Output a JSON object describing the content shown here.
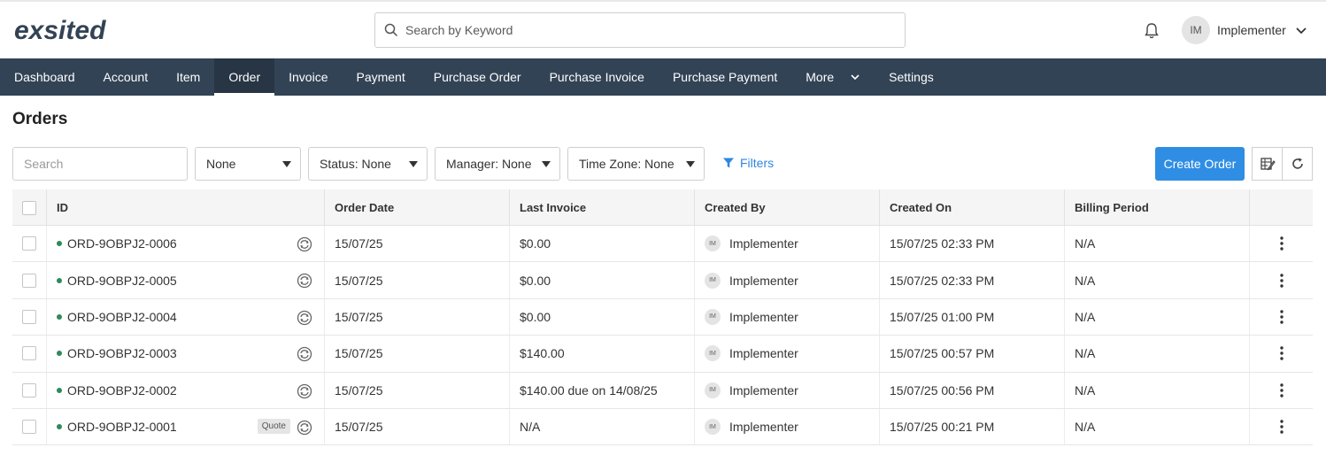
{
  "brand": {
    "logo_text": "exsited",
    "accent": "#f15a29",
    "dark": "#324355"
  },
  "header": {
    "search_placeholder": "Search by Keyword",
    "user_initials": "IM",
    "user_name": "Implementer"
  },
  "nav": {
    "items": [
      {
        "label": "Dashboard"
      },
      {
        "label": "Account"
      },
      {
        "label": "Item"
      },
      {
        "label": "Order",
        "active": true
      },
      {
        "label": "Invoice"
      },
      {
        "label": "Payment"
      },
      {
        "label": "Purchase Order"
      },
      {
        "label": "Purchase Invoice"
      },
      {
        "label": "Purchase Payment"
      },
      {
        "label": "More",
        "has_dropdown": true
      },
      {
        "label": "Settings"
      }
    ]
  },
  "page": {
    "title": "Orders"
  },
  "toolbar": {
    "search_placeholder": "Search",
    "dropdown_none": "None",
    "dropdown_status": "Status: None",
    "dropdown_manager": "Manager: None",
    "dropdown_timezone": "Time Zone: None",
    "filters_label": "Filters",
    "create_label": "Create Order"
  },
  "table": {
    "columns": [
      "ID",
      "Order Date",
      "Last Invoice",
      "Created By",
      "Created On",
      "Billing Period"
    ],
    "rows": [
      {
        "id": "ORD-9OBPJ2-0006",
        "quote": "",
        "order_date": "15/07/25",
        "last_invoice": "$0.00",
        "created_by": "Implementer",
        "created_by_initials": "IM",
        "created_on": "15/07/25 02:33 PM",
        "billing_period": "N/A"
      },
      {
        "id": "ORD-9OBPJ2-0005",
        "quote": "",
        "order_date": "15/07/25",
        "last_invoice": "$0.00",
        "created_by": "Implementer",
        "created_by_initials": "IM",
        "created_on": "15/07/25 02:33 PM",
        "billing_period": "N/A"
      },
      {
        "id": "ORD-9OBPJ2-0004",
        "quote": "",
        "order_date": "15/07/25",
        "last_invoice": "$0.00",
        "created_by": "Implementer",
        "created_by_initials": "IM",
        "created_on": "15/07/25 01:00 PM",
        "billing_period": "N/A"
      },
      {
        "id": "ORD-9OBPJ2-0003",
        "quote": "",
        "order_date": "15/07/25",
        "last_invoice": "$140.00",
        "created_by": "Implementer",
        "created_by_initials": "IM",
        "created_on": "15/07/25 00:57 PM",
        "billing_period": "N/A"
      },
      {
        "id": "ORD-9OBPJ2-0002",
        "quote": "",
        "order_date": "15/07/25",
        "last_invoice": "$140.00 due on 14/08/25",
        "created_by": "Implementer",
        "created_by_initials": "IM",
        "created_on": "15/07/25 00:56 PM",
        "billing_period": "N/A"
      },
      {
        "id": "ORD-9OBPJ2-0001",
        "quote": "Quote",
        "order_date": "15/07/25",
        "last_invoice": "N/A",
        "created_by": "Implementer",
        "created_by_initials": "IM",
        "created_on": "15/07/25 00:21 PM",
        "billing_period": "N/A"
      }
    ]
  }
}
